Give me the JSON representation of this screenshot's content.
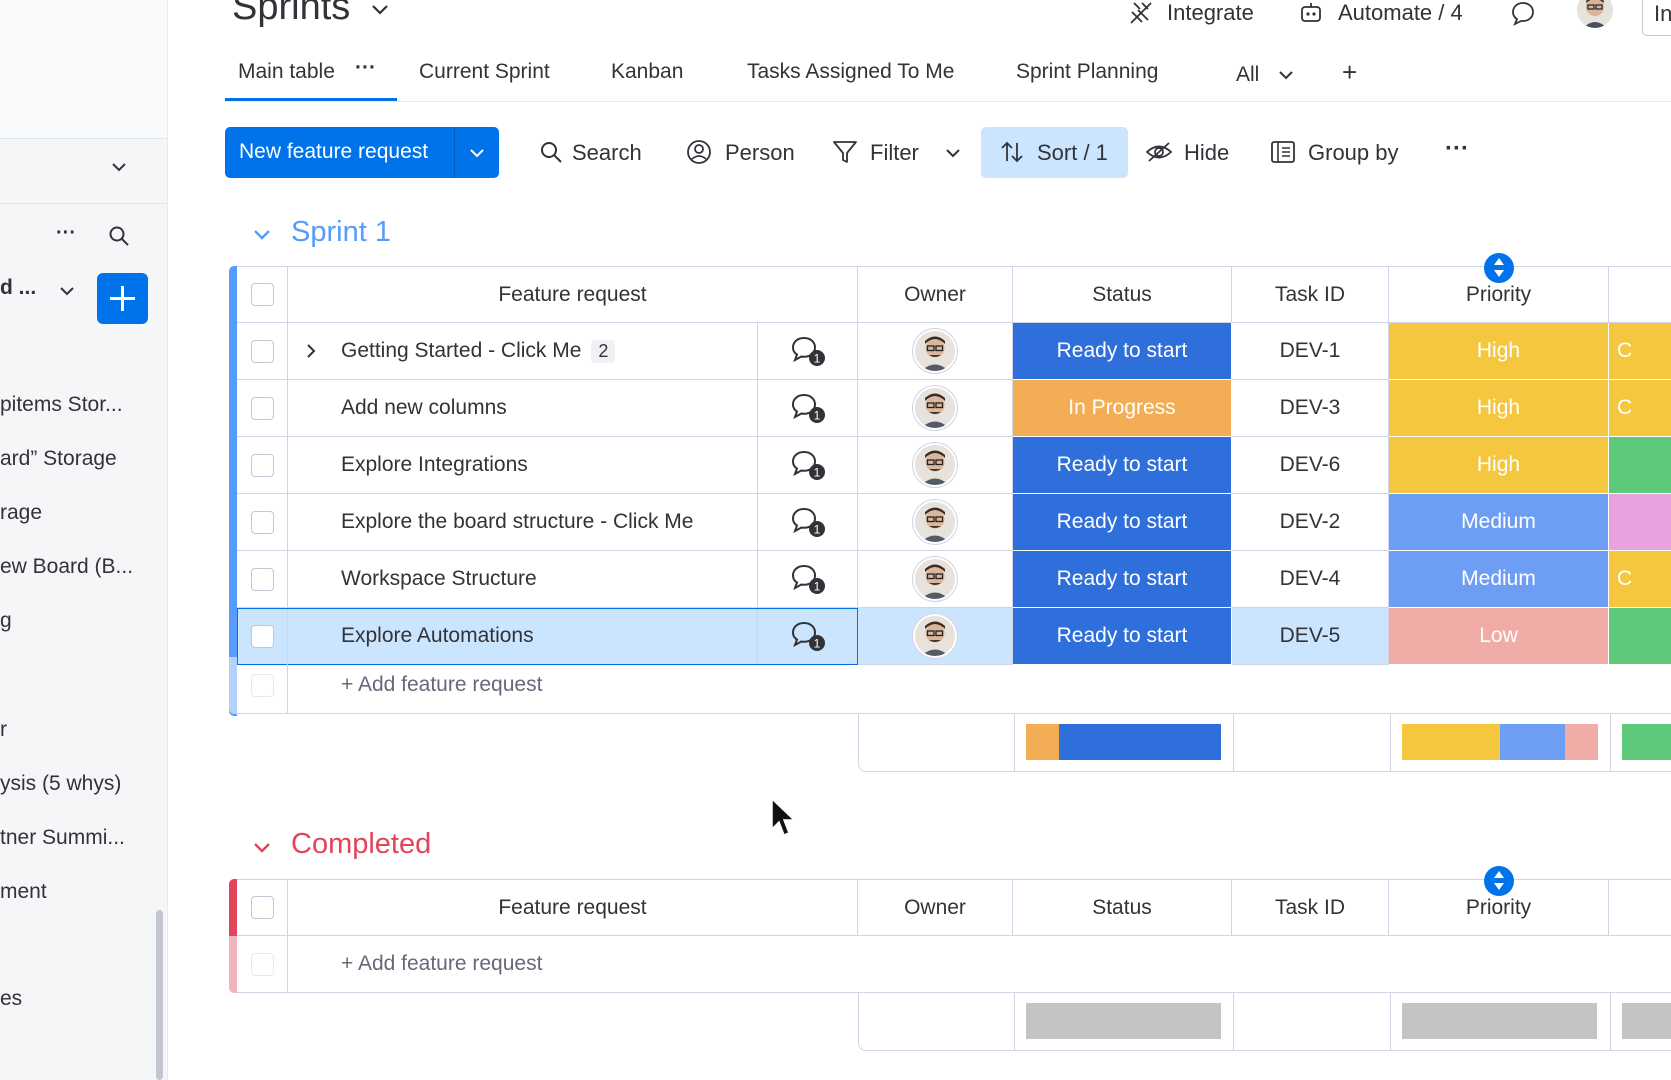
{
  "sidebar": {
    "workspace_label": "d ...",
    "items": [
      {
        "label": "pitems Stor..."
      },
      {
        "label": "ard” Storage"
      },
      {
        "label": "rage"
      },
      {
        "label": "ew Board (B..."
      },
      {
        "label": "g"
      },
      {
        "label": "r"
      },
      {
        "label": "ysis (5 whys)"
      },
      {
        "label": "tner Summi..."
      },
      {
        "label": "ment"
      },
      {
        "label": "es"
      }
    ]
  },
  "header": {
    "title": "Sprints",
    "integrate": "Integrate",
    "automate": "Automate / 4",
    "invite_partial": "In"
  },
  "tabs": [
    {
      "label": "Main table"
    },
    {
      "label": "Current Sprint"
    },
    {
      "label": "Kanban"
    },
    {
      "label": "Tasks Assigned To Me"
    },
    {
      "label": "Sprint Planning"
    },
    {
      "label": "All"
    }
  ],
  "toolbar": {
    "new_item": "New feature request",
    "search": "Search",
    "person": "Person",
    "filter": "Filter",
    "sort": "Sort / 1",
    "hide": "Hide",
    "group_by": "Group by"
  },
  "colors": {
    "ready": "#2f6fdb",
    "in_progress": "#f3ae55",
    "high": "#f4c73e",
    "medium": "#6d9ef3",
    "low": "#f0aca6",
    "group1": "#579bfc",
    "group2": "#e2445c"
  },
  "columns": {
    "item": "Feature request",
    "owner": "Owner",
    "status": "Status",
    "task_id": "Task ID",
    "priority": "Priority"
  },
  "groups": [
    {
      "title": "Sprint 1",
      "rows": [
        {
          "name": "Getting Started - Click Me",
          "subitems": "2",
          "updates": "1",
          "status": "Ready to start",
          "task_id": "DEV-1",
          "priority": "High",
          "extra": "C"
        },
        {
          "name": "Add new columns",
          "updates": "1",
          "status": "In Progress",
          "task_id": "DEV-3",
          "priority": "High",
          "extra": "C"
        },
        {
          "name": "Explore Integrations",
          "updates": "1",
          "status": "Ready to start",
          "task_id": "DEV-6",
          "priority": "High",
          "extra": ""
        },
        {
          "name": "Explore the board structure - Click Me",
          "updates": "1",
          "status": "Ready to start",
          "task_id": "DEV-2",
          "priority": "Medium",
          "extra": ""
        },
        {
          "name": "Workspace Structure",
          "updates": "1",
          "status": "Ready to start",
          "task_id": "DEV-4",
          "priority": "Medium",
          "extra": "C"
        },
        {
          "name": "Explore Automations",
          "updates": "1",
          "status": "Ready to start",
          "task_id": "DEV-5",
          "priority": "Low",
          "extra": ""
        }
      ],
      "add_label": "+ Add feature request",
      "status_summary": [
        {
          "label": "In Progress",
          "fraction": 0.167
        },
        {
          "label": "Ready to start",
          "fraction": 0.833
        }
      ],
      "priority_summary": [
        {
          "label": "High",
          "fraction": 0.5
        },
        {
          "label": "Medium",
          "fraction": 0.333
        },
        {
          "label": "Low",
          "fraction": 0.167
        }
      ]
    },
    {
      "title": "Completed",
      "rows": [],
      "add_label": "+ Add feature request"
    }
  ]
}
